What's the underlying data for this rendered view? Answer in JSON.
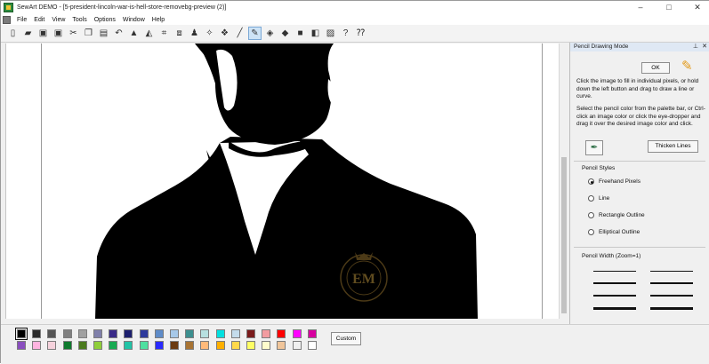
{
  "window": {
    "title": "SewArt DEMO - [5-president-lincoln-war-is-hell-store-removebg-preview (2)]",
    "controls": [
      "–",
      "□",
      "✕"
    ]
  },
  "menu": [
    "File",
    "Edit",
    "View",
    "Tools",
    "Options",
    "Window",
    "Help"
  ],
  "toolbar": [
    {
      "icon": "new-file-icon",
      "glyph": "▯"
    },
    {
      "icon": "open-folder-icon",
      "glyph": "▰"
    },
    {
      "icon": "save-icon",
      "glyph": "▣"
    },
    {
      "icon": "save-as-icon",
      "glyph": "▣"
    },
    {
      "icon": "cut-icon",
      "glyph": "✂"
    },
    {
      "icon": "copy-icon",
      "glyph": "❐"
    },
    {
      "icon": "paste-icon",
      "glyph": "▤"
    },
    {
      "icon": "undo-icon",
      "glyph": "↶"
    },
    {
      "icon": "flip-vertical-icon",
      "glyph": "▲"
    },
    {
      "icon": "flip-horizontal-icon",
      "glyph": "◭"
    },
    {
      "icon": "crop-icon",
      "glyph": "⌗"
    },
    {
      "icon": "resize-icon",
      "glyph": "⧈"
    },
    {
      "icon": "stamp-icon",
      "glyph": "♟"
    },
    {
      "icon": "magic-wand-icon",
      "glyph": "✧"
    },
    {
      "icon": "color-merge-icon",
      "glyph": "❖"
    },
    {
      "icon": "line-icon",
      "glyph": "╱"
    },
    {
      "icon": "pencil-icon",
      "glyph": "✎",
      "selected": true
    },
    {
      "icon": "fill-icon",
      "glyph": "◈"
    },
    {
      "icon": "eraser-icon",
      "glyph": "◆"
    },
    {
      "icon": "color-select-icon",
      "glyph": "■"
    },
    {
      "icon": "convert-icon",
      "glyph": "◧"
    },
    {
      "icon": "save-embroidery-icon",
      "glyph": "▨"
    },
    {
      "icon": "help-icon",
      "glyph": "?"
    },
    {
      "icon": "context-help-icon",
      "glyph": "⁇"
    }
  ],
  "panel": {
    "title": "Pencil Drawing Mode",
    "ok_label": "OK",
    "instruction_1": "Click the image to fill in individual pixels, or hold down the left button and drag to draw a line or curve.",
    "instruction_2": "Select the pencil color from the palette bar, or Ctrl-click an image color or click the eye-dropper and drag it over the desired image color and click.",
    "thicken_label": "Thicken Lines",
    "styles_label": "Pencil Styles",
    "styles": [
      {
        "label": "Freehand Pixels",
        "selected": true
      },
      {
        "label": "Line",
        "selected": false
      },
      {
        "label": "Rectangle Outline",
        "selected": false
      },
      {
        "label": "Elliptical Outline",
        "selected": false
      }
    ],
    "width_label": "Pencil Width (Zoom=1)"
  },
  "watermark": {
    "monogram": "EM"
  },
  "palette": {
    "custom_label": "Custom",
    "selected_index": 0,
    "row1": [
      "#000000",
      "#2b2b2b",
      "#555555",
      "#808080",
      "#a0a0a0",
      "#7f7faa",
      "#3a2a88",
      "#1c1f6e",
      "#2e3a9c",
      "#5f8cc9",
      "#a6c8e8",
      "#3c8f8f",
      "#b7e0e0",
      "#00e0e0",
      "#c4dcec",
      "#7a1a1a",
      "#f29ca0",
      "#ff0000",
      "#ff00ff",
      "#d800a0"
    ],
    "row2": [
      "#8a4fbf",
      "#ffb4e0",
      "#f5d2dc",
      "#0e7a2e",
      "#4b7a1e",
      "#8fce3a",
      "#18aa52",
      "#22c3a6",
      "#4fe0a0",
      "#2a2aff",
      "#6a3a10",
      "#a87434",
      "#ffba7a",
      "#ffb000",
      "#ffd94a",
      "#ffff66",
      "#fffccc",
      "#f0c59a",
      "#f0f0f0",
      "#ffffff"
    ]
  }
}
